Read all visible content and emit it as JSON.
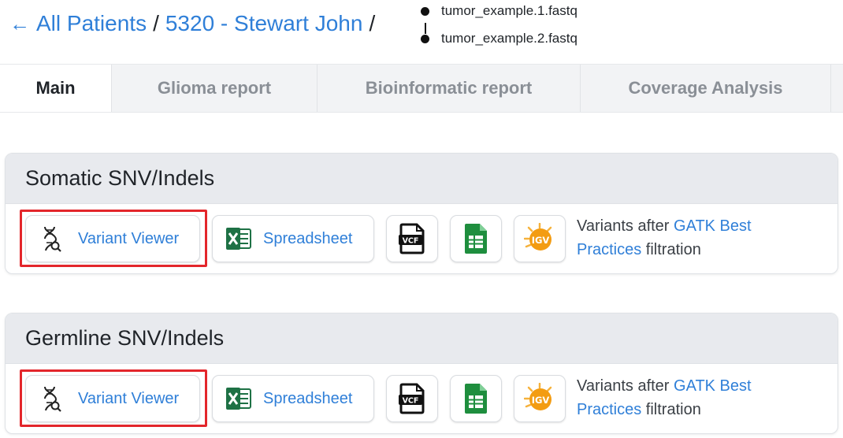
{
  "breadcrumb": {
    "back_label": "All Patients",
    "separator": "/",
    "patient_label": "5320 - Stewart John",
    "files": [
      "tumor_example.1.fastq",
      "tumor_example.2.fastq"
    ]
  },
  "tabs": [
    {
      "label": "Main",
      "active": true
    },
    {
      "label": "Glioma report",
      "active": false
    },
    {
      "label": "Bioinformatic report",
      "active": false
    },
    {
      "label": "Coverage Analysis",
      "active": false
    }
  ],
  "sections": [
    {
      "title": "Somatic SNV/Indels",
      "variant_viewer_label": "Variant Viewer",
      "spreadsheet_label": "Spreadsheet",
      "vcf_icon_text": "VCF",
      "igv_icon_text": "IGV",
      "desc_before": "Variants after ",
      "desc_link": "GATK Best Practices",
      "desc_after": " filtration"
    },
    {
      "title": "Germline SNV/Indels",
      "variant_viewer_label": "Variant Viewer",
      "spreadsheet_label": "Spreadsheet",
      "vcf_icon_text": "VCF",
      "igv_icon_text": "IGV",
      "desc_before": "Variants after ",
      "desc_link": "GATK Best Practices",
      "desc_after": " filtration"
    }
  ],
  "colors": {
    "link": "#2f7fd8",
    "highlight": "#e3262b",
    "excel_green": "#1e7145",
    "sheet_green": "#1e8e3e",
    "igv_orange": "#f39c12"
  },
  "icons": {
    "back": "arrow-left-icon",
    "dna": "dna-search-icon",
    "excel": "excel-icon",
    "vcf": "vcf-file-icon",
    "sheet": "spreadsheet-file-icon",
    "igv": "igv-icon"
  }
}
